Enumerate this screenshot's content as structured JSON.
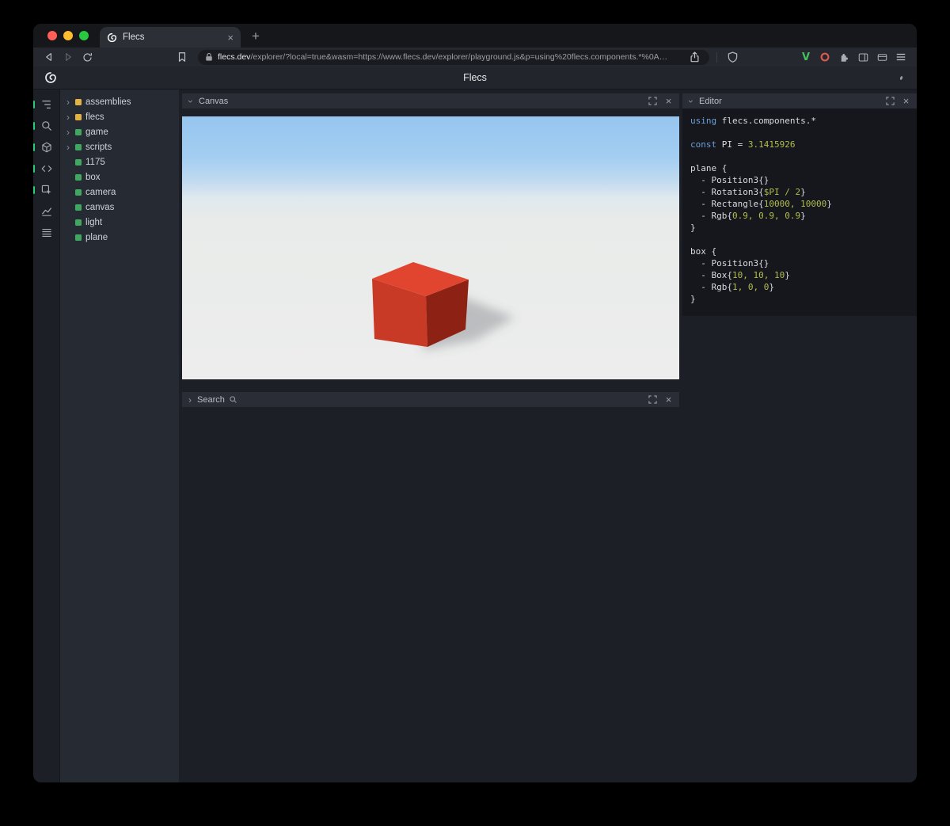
{
  "browser": {
    "tab_title": "Flecs",
    "new_tab_label": "+",
    "url_domain": "flecs.dev",
    "url_rest": "/explorer/?local=true&wasm=https://www.flecs.dev/explorer/playground.js&p=using%20flecs.components.*%0A…"
  },
  "page": {
    "title": "Flecs"
  },
  "panels": {
    "canvas_title": "Canvas",
    "search_title": "Search",
    "editor_title": "Editor"
  },
  "sidebar": {
    "icons": [
      "entity-tree-icon",
      "search-icon",
      "entities-cube-icon",
      "code-icon",
      "inspect-icon",
      "stats-chart-icon",
      "archetypes-icon"
    ]
  },
  "tree": {
    "items": [
      {
        "label": "assemblies",
        "color": "yellow",
        "expandable": true
      },
      {
        "label": "flecs",
        "color": "yellow",
        "expandable": true
      },
      {
        "label": "game",
        "color": "green",
        "expandable": true
      },
      {
        "label": "scripts",
        "color": "green",
        "expandable": true
      },
      {
        "label": "1175",
        "color": "green",
        "expandable": false
      },
      {
        "label": "box",
        "color": "green",
        "expandable": false
      },
      {
        "label": "camera",
        "color": "green",
        "expandable": false
      },
      {
        "label": "canvas",
        "color": "green",
        "expandable": false
      },
      {
        "label": "light",
        "color": "green",
        "expandable": false
      },
      {
        "label": "plane",
        "color": "green",
        "expandable": false
      }
    ]
  },
  "editor": {
    "lines": [
      [
        [
          "kw",
          "using"
        ],
        [
          "pl",
          " flecs.components.*"
        ]
      ],
      [],
      [
        [
          "kw",
          "const"
        ],
        [
          "pl",
          " PI = "
        ],
        [
          "num",
          "3.1415926"
        ]
      ],
      [],
      [
        [
          "pl",
          "plane {"
        ]
      ],
      [
        [
          "pl",
          "  - Position3{}"
        ]
      ],
      [
        [
          "pl",
          "  - Rotation3{"
        ],
        [
          "num",
          "$PI / 2"
        ],
        [
          "pl",
          "}"
        ]
      ],
      [
        [
          "pl",
          "  - Rectangle{"
        ],
        [
          "num",
          "10000, 10000"
        ],
        [
          "pl",
          "}"
        ]
      ],
      [
        [
          "pl",
          "  - Rgb{"
        ],
        [
          "num",
          "0.9, 0.9, 0.9"
        ],
        [
          "pl",
          "}"
        ]
      ],
      [
        [
          "pl",
          "}"
        ]
      ],
      [],
      [
        [
          "pl",
          "box {"
        ]
      ],
      [
        [
          "pl",
          "  - Position3{}"
        ]
      ],
      [
        [
          "pl",
          "  - Box{"
        ],
        [
          "num",
          "10, 10, 10"
        ],
        [
          "pl",
          "}"
        ]
      ],
      [
        [
          "pl",
          "  - Rgb{"
        ],
        [
          "num",
          "1, 0, 0"
        ],
        [
          "pl",
          "}"
        ]
      ],
      [
        [
          "pl",
          "}"
        ]
      ]
    ]
  },
  "colors": {
    "traffic_red": "#ff5f57",
    "traffic_yellow": "#febc2e",
    "traffic_green": "#28c840",
    "tree_yellow": "#e3b341",
    "tree_green": "#3fa75f",
    "syntax_keyword": "#6e9fd6",
    "syntax_number": "#b4bd4f",
    "syntax_plain": "#d8dbe0",
    "box_top": "#e2452f",
    "box_front": "#c93a26",
    "box_side": "#8c2114",
    "sky_top": "#96c5ef",
    "sky_horizon": "#dfe9ee",
    "ground": "#e9ebea"
  }
}
